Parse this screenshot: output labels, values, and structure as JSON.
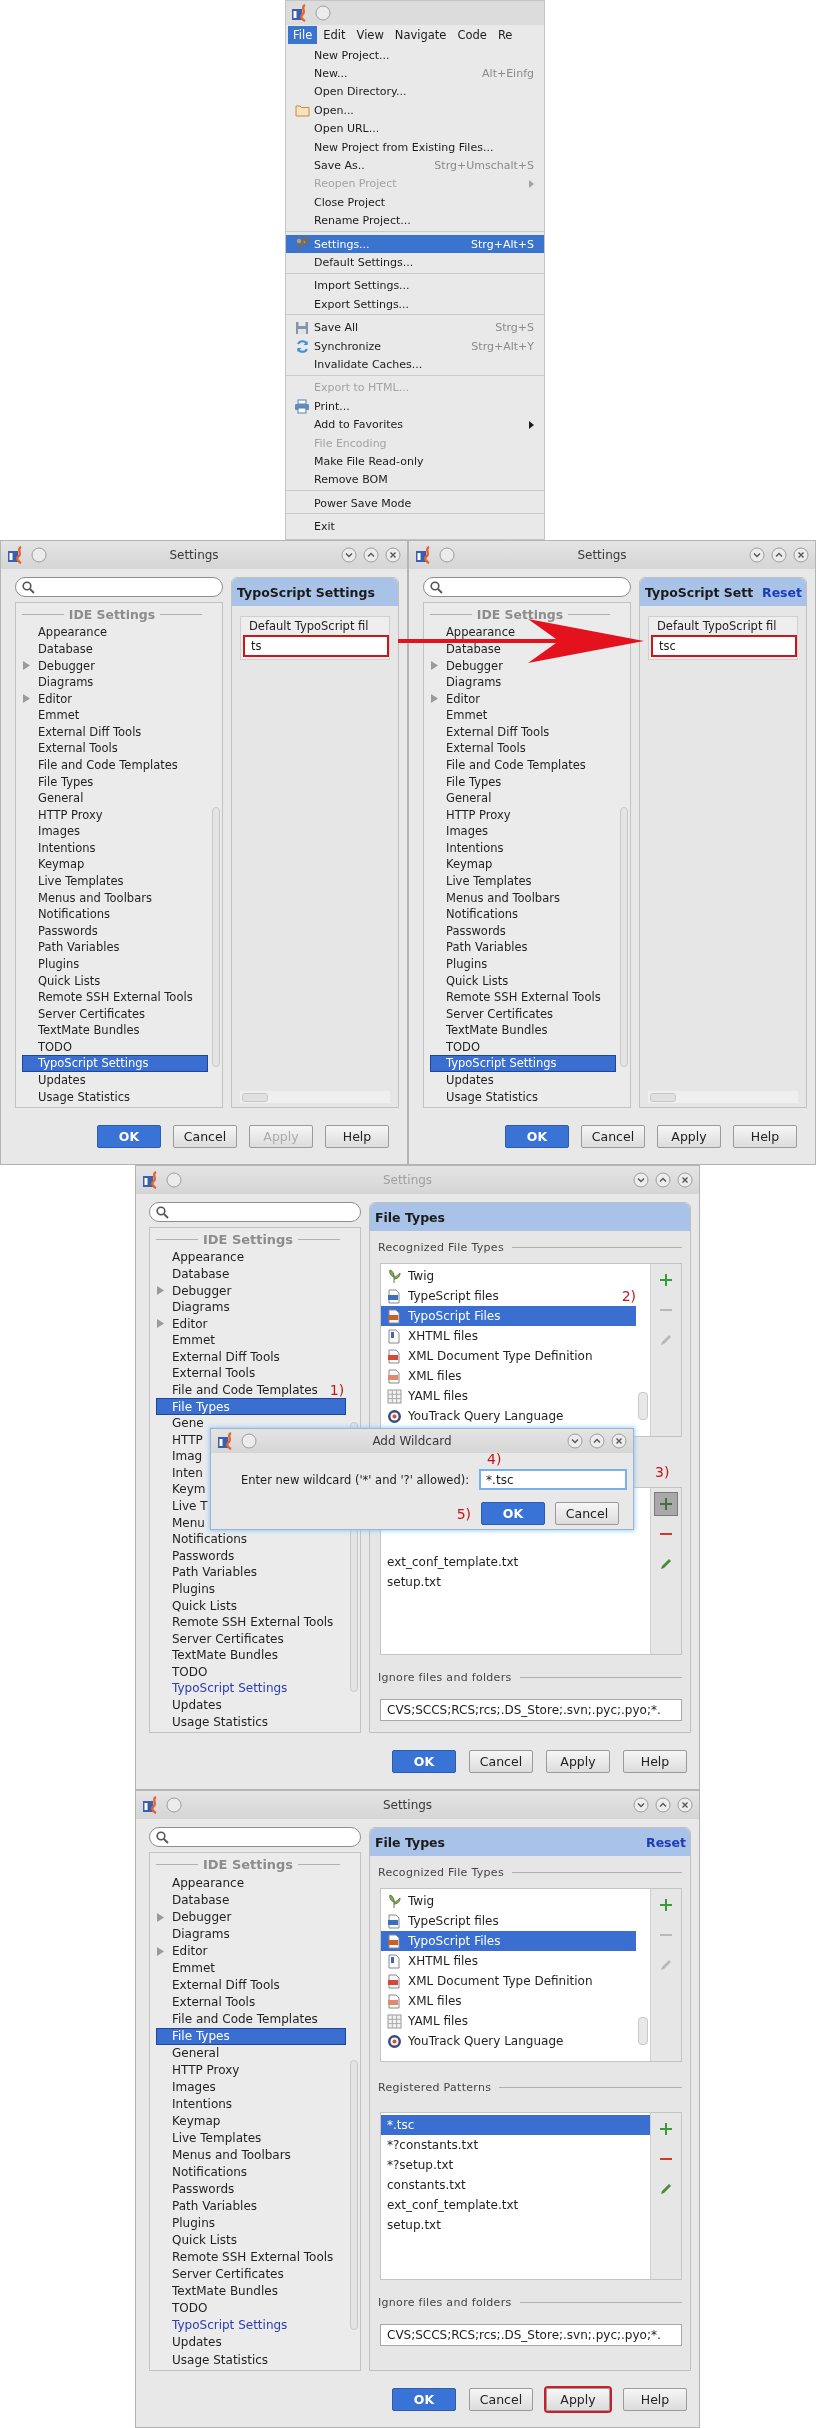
{
  "menu_window": {
    "menubar": [
      {
        "label": "File",
        "selected": true
      },
      {
        "label": "Edit",
        "selected": false
      },
      {
        "label": "View",
        "selected": false
      },
      {
        "label": "Navigate",
        "selected": false
      },
      {
        "label": "Code",
        "selected": false
      },
      {
        "label": "Re",
        "selected": false
      }
    ],
    "menu": [
      {
        "kind": "item",
        "label": "New Project...",
        "selected": false,
        "disabled": false,
        "submenu": false
      },
      {
        "kind": "item",
        "label": "New...",
        "shortcut": "Alt+Einfg",
        "selected": false,
        "disabled": false,
        "submenu": false
      },
      {
        "kind": "item",
        "label": "Open Directory...",
        "selected": false,
        "disabled": false,
        "submenu": false
      },
      {
        "kind": "item",
        "label": "Open...",
        "selected": false,
        "disabled": false,
        "submenu": false
      },
      {
        "kind": "item",
        "label": "Open URL...",
        "selected": false,
        "disabled": false,
        "submenu": false
      },
      {
        "kind": "item",
        "label": "New Project from Existing Files...",
        "selected": false,
        "disabled": false,
        "submenu": false
      },
      {
        "kind": "item",
        "label": "Save As..",
        "shortcut": "Strg+Umschalt+S",
        "selected": false,
        "disabled": false,
        "submenu": false
      },
      {
        "kind": "item",
        "label": "Reopen Project",
        "selected": false,
        "disabled": true,
        "submenu": true
      },
      {
        "kind": "item",
        "label": "Close Project",
        "selected": false,
        "disabled": false,
        "submenu": false
      },
      {
        "kind": "item",
        "label": "Rename Project...",
        "selected": false,
        "disabled": false,
        "submenu": false
      },
      {
        "kind": "separator"
      },
      {
        "kind": "item",
        "label": "Settings...",
        "shortcut": "Strg+Alt+S",
        "selected": true,
        "disabled": false,
        "submenu": false
      },
      {
        "kind": "item",
        "label": "Default Settings...",
        "selected": false,
        "disabled": false,
        "submenu": false
      },
      {
        "kind": "separator"
      },
      {
        "kind": "item",
        "label": "Import Settings...",
        "selected": false,
        "disabled": false,
        "submenu": false
      },
      {
        "kind": "item",
        "label": "Export Settings...",
        "selected": false,
        "disabled": false,
        "submenu": false
      },
      {
        "kind": "separator"
      },
      {
        "kind": "item",
        "label": "Save All",
        "shortcut": "Strg+S",
        "selected": false,
        "disabled": false,
        "submenu": false
      },
      {
        "kind": "item",
        "label": "Synchronize",
        "shortcut": "Strg+Alt+Y",
        "selected": false,
        "disabled": false,
        "submenu": false
      },
      {
        "kind": "item",
        "label": "Invalidate Caches...",
        "selected": false,
        "disabled": false,
        "submenu": false
      },
      {
        "kind": "separator"
      },
      {
        "kind": "item",
        "label": "Export to HTML...",
        "selected": false,
        "disabled": true,
        "submenu": false
      },
      {
        "kind": "item",
        "label": "Print...",
        "selected": false,
        "disabled": false,
        "submenu": false
      },
      {
        "kind": "item",
        "label": "Add to Favorites",
        "selected": false,
        "disabled": false,
        "submenu": true
      },
      {
        "kind": "item",
        "label": "File Encoding",
        "selected": false,
        "disabled": true,
        "submenu": false
      },
      {
        "kind": "item",
        "label": "Make File Read-only",
        "selected": false,
        "disabled": false,
        "submenu": false
      },
      {
        "kind": "item",
        "label": "Remove BOM",
        "selected": false,
        "disabled": false,
        "submenu": false
      },
      {
        "kind": "separator"
      },
      {
        "kind": "item",
        "label": "Power Save Mode",
        "selected": false,
        "disabled": false,
        "submenu": false
      },
      {
        "kind": "separator"
      },
      {
        "kind": "item",
        "label": "Exit",
        "selected": false,
        "disabled": false,
        "submenu": false
      }
    ]
  },
  "dialogs": [
    {
      "title": "Settings",
      "active": true,
      "tree": {
        "heading": "IDE Settings",
        "items": [
          {
            "label": "Appearance",
            "expandable": false,
            "selected": false,
            "modified": false
          },
          {
            "label": "Database",
            "expandable": false,
            "selected": false,
            "modified": false
          },
          {
            "label": "Debugger",
            "expandable": true,
            "selected": false,
            "modified": false
          },
          {
            "label": "Diagrams",
            "expandable": false,
            "selected": false,
            "modified": false
          },
          {
            "label": "Editor",
            "expandable": true,
            "selected": false,
            "modified": false
          },
          {
            "label": "Emmet",
            "expandable": false,
            "selected": false,
            "modified": false
          },
          {
            "label": "External Diff Tools",
            "expandable": false,
            "selected": false,
            "modified": false
          },
          {
            "label": "External Tools",
            "expandable": false,
            "selected": false,
            "modified": false
          },
          {
            "label": "File and Code Templates",
            "expandable": false,
            "selected": false,
            "modified": false
          },
          {
            "label": "File Types",
            "expandable": false,
            "selected": false,
            "modified": false
          },
          {
            "label": "General",
            "expandable": false,
            "selected": false,
            "modified": false
          },
          {
            "label": "HTTP Proxy",
            "expandable": false,
            "selected": false,
            "modified": false
          },
          {
            "label": "Images",
            "expandable": false,
            "selected": false,
            "modified": false
          },
          {
            "label": "Intentions",
            "expandable": false,
            "selected": false,
            "modified": false
          },
          {
            "label": "Keymap",
            "expandable": false,
            "selected": false,
            "modified": false
          },
          {
            "label": "Live Templates",
            "expandable": false,
            "selected": false,
            "modified": false
          },
          {
            "label": "Menus and Toolbars",
            "expandable": false,
            "selected": false,
            "modified": false
          },
          {
            "label": "Notifications",
            "expandable": false,
            "selected": false,
            "modified": false
          },
          {
            "label": "Passwords",
            "expandable": false,
            "selected": false,
            "modified": false
          },
          {
            "label": "Path Variables",
            "expandable": false,
            "selected": false,
            "modified": false
          },
          {
            "label": "Plugins",
            "expandable": false,
            "selected": false,
            "modified": false
          },
          {
            "label": "Quick Lists",
            "expandable": false,
            "selected": false,
            "modified": false
          },
          {
            "label": "Remote SSH External Tools",
            "expandable": false,
            "selected": false,
            "modified": false
          },
          {
            "label": "Server Certificates",
            "expandable": false,
            "selected": false,
            "modified": false
          },
          {
            "label": "TextMate Bundles",
            "expandable": false,
            "selected": false,
            "modified": false
          },
          {
            "label": "TODO",
            "expandable": false,
            "selected": false,
            "modified": false
          },
          {
            "label": "TypoScript Settings",
            "expandable": false,
            "selected": true,
            "modified": false
          },
          {
            "label": "Updates",
            "expandable": false,
            "selected": false,
            "modified": false
          },
          {
            "label": "Usage Statistics",
            "expandable": false,
            "selected": false,
            "modified": false
          }
        ]
      },
      "panel": {
        "kind": "typoscript",
        "title": "TypoScript Settings",
        "field_label": "Default TypoScript fil",
        "field_value": "ts",
        "field_highlighted": true
      },
      "buttons": [
        {
          "label": "OK",
          "kind": "primary",
          "disabled": false,
          "highlighted": false
        },
        {
          "label": "Cancel",
          "kind": "normal",
          "disabled": false,
          "highlighted": false
        },
        {
          "label": "Apply",
          "kind": "normal",
          "disabled": true,
          "highlighted": false
        },
        {
          "label": "Help",
          "kind": "normal",
          "disabled": false,
          "highlighted": false
        }
      ]
    },
    {
      "title": "Settings",
      "active": true,
      "tree": {
        "heading": "IDE Settings",
        "items": [
          {
            "label": "Appearance",
            "expandable": false,
            "selected": false,
            "modified": false
          },
          {
            "label": "Database",
            "expandable": false,
            "selected": false,
            "modified": false
          },
          {
            "label": "Debugger",
            "expandable": true,
            "selected": false,
            "modified": false
          },
          {
            "label": "Diagrams",
            "expandable": false,
            "selected": false,
            "modified": false
          },
          {
            "label": "Editor",
            "expandable": true,
            "selected": false,
            "modified": false
          },
          {
            "label": "Emmet",
            "expandable": false,
            "selected": false,
            "modified": false
          },
          {
            "label": "External Diff Tools",
            "expandable": false,
            "selected": false,
            "modified": false
          },
          {
            "label": "External Tools",
            "expandable": false,
            "selected": false,
            "modified": false
          },
          {
            "label": "File and Code Templates",
            "expandable": false,
            "selected": false,
            "modified": false
          },
          {
            "label": "File Types",
            "expandable": false,
            "selected": false,
            "modified": false
          },
          {
            "label": "General",
            "expandable": false,
            "selected": false,
            "modified": false
          },
          {
            "label": "HTTP Proxy",
            "expandable": false,
            "selected": false,
            "modified": false
          },
          {
            "label": "Images",
            "expandable": false,
            "selected": false,
            "modified": false
          },
          {
            "label": "Intentions",
            "expandable": false,
            "selected": false,
            "modified": false
          },
          {
            "label": "Keymap",
            "expandable": false,
            "selected": false,
            "modified": false
          },
          {
            "label": "Live Templates",
            "expandable": false,
            "selected": false,
            "modified": false
          },
          {
            "label": "Menus and Toolbars",
            "expandable": false,
            "selected": false,
            "modified": false
          },
          {
            "label": "Notifications",
            "expandable": false,
            "selected": false,
            "modified": false
          },
          {
            "label": "Passwords",
            "expandable": false,
            "selected": false,
            "modified": false
          },
          {
            "label": "Path Variables",
            "expandable": false,
            "selected": false,
            "modified": false
          },
          {
            "label": "Plugins",
            "expandable": false,
            "selected": false,
            "modified": false
          },
          {
            "label": "Quick Lists",
            "expandable": false,
            "selected": false,
            "modified": false
          },
          {
            "label": "Remote SSH External Tools",
            "expandable": false,
            "selected": false,
            "modified": false
          },
          {
            "label": "Server Certificates",
            "expandable": false,
            "selected": false,
            "modified": false
          },
          {
            "label": "TextMate Bundles",
            "expandable": false,
            "selected": false,
            "modified": false
          },
          {
            "label": "TODO",
            "expandable": false,
            "selected": false,
            "modified": false
          },
          {
            "label": "TypoScript Settings",
            "expandable": false,
            "selected": true,
            "modified": false
          },
          {
            "label": "Updates",
            "expandable": false,
            "selected": false,
            "modified": false
          },
          {
            "label": "Usage Statistics",
            "expandable": false,
            "selected": false,
            "modified": false
          }
        ]
      },
      "panel": {
        "kind": "typoscript",
        "title": "TypoScript Sett",
        "reset": "Reset",
        "field_label": "Default TypoScript fil",
        "field_value": "tsc",
        "field_highlighted": true
      },
      "buttons": [
        {
          "label": "OK",
          "kind": "primary",
          "disabled": false,
          "highlighted": false
        },
        {
          "label": "Cancel",
          "kind": "normal",
          "disabled": false,
          "highlighted": false
        },
        {
          "label": "Apply",
          "kind": "normal",
          "disabled": false,
          "highlighted": false
        },
        {
          "label": "Help",
          "kind": "normal",
          "disabled": false,
          "highlighted": false
        }
      ]
    },
    {
      "title": "Settings",
      "active": false,
      "tree": {
        "heading": "IDE Settings",
        "items": [
          {
            "label": "Appearance",
            "expandable": false,
            "selected": false,
            "modified": false
          },
          {
            "label": "Database",
            "expandable": false,
            "selected": false,
            "modified": false
          },
          {
            "label": "Debugger",
            "expandable": true,
            "selected": false,
            "modified": false
          },
          {
            "label": "Diagrams",
            "expandable": false,
            "selected": false,
            "modified": false
          },
          {
            "label": "Editor",
            "expandable": true,
            "selected": false,
            "modified": false
          },
          {
            "label": "Emmet",
            "expandable": false,
            "selected": false,
            "modified": false
          },
          {
            "label": "External Diff Tools",
            "expandable": false,
            "selected": false,
            "modified": false
          },
          {
            "label": "External Tools",
            "expandable": false,
            "selected": false,
            "modified": false
          },
          {
            "label": "File and Code Templates",
            "expandable": false,
            "selected": false,
            "modified": false,
            "note": "1)"
          },
          {
            "label": "File Types",
            "expandable": false,
            "selected": true,
            "modified": false
          },
          {
            "label": "Gene",
            "expandable": false,
            "selected": false,
            "modified": false
          },
          {
            "label": "HTTP",
            "expandable": false,
            "selected": false,
            "modified": false
          },
          {
            "label": "Imag",
            "expandable": false,
            "selected": false,
            "modified": false
          },
          {
            "label": "Inten",
            "expandable": false,
            "selected": false,
            "modified": false
          },
          {
            "label": "Keym",
            "expandable": false,
            "selected": false,
            "modified": false
          },
          {
            "label": "Live T",
            "expandable": false,
            "selected": false,
            "modified": false
          },
          {
            "label": "Menu",
            "expandable": false,
            "selected": false,
            "modified": false
          },
          {
            "label": "Notifications",
            "expandable": false,
            "selected": false,
            "modified": false
          },
          {
            "label": "Passwords",
            "expandable": false,
            "selected": false,
            "modified": false
          },
          {
            "label": "Path Variables",
            "expandable": false,
            "selected": false,
            "modified": false
          },
          {
            "label": "Plugins",
            "expandable": false,
            "selected": false,
            "modified": false
          },
          {
            "label": "Quick Lists",
            "expandable": false,
            "selected": false,
            "modified": false
          },
          {
            "label": "Remote SSH External Tools",
            "expandable": false,
            "selected": false,
            "modified": false
          },
          {
            "label": "Server Certificates",
            "expandable": false,
            "selected": false,
            "modified": false
          },
          {
            "label": "TextMate Bundles",
            "expandable": false,
            "selected": false,
            "modified": false
          },
          {
            "label": "TODO",
            "expandable": false,
            "selected": false,
            "modified": false
          },
          {
            "label": "TypoScript Settings",
            "expandable": false,
            "selected": false,
            "modified": true
          },
          {
            "label": "Updates",
            "expandable": false,
            "selected": false,
            "modified": false
          },
          {
            "label": "Usage Statistics",
            "expandable": false,
            "selected": false,
            "modified": false
          }
        ]
      },
      "panel": {
        "kind": "filetypes",
        "title": "File Types",
        "recognized_label": "Recognized File Types",
        "file_types": [
          {
            "label": "Twig",
            "selected": false
          },
          {
            "label": "TypeScript files",
            "selected": false,
            "note": "2)"
          },
          {
            "label": "TypoScript Files",
            "selected": true
          },
          {
            "label": "XHTML files",
            "selected": false
          },
          {
            "label": "XML Document Type Definition",
            "selected": false
          },
          {
            "label": "XML files",
            "selected": false
          },
          {
            "label": "YAML files",
            "selected": false
          },
          {
            "label": "YouTrack Query Language",
            "selected": false
          }
        ],
        "add_pressed": true,
        "add_note": "3)",
        "patterns": [
          {
            "label": "ext_conf_template.txt",
            "selected": false
          },
          {
            "label": "setup.txt",
            "selected": false
          }
        ],
        "ignore_label": "Ignore files and folders",
        "ignore_value": "CVS;SCCS;RCS;rcs;.DS_Store;.svn;.pyc;.pyo;*."
      },
      "popup": {
        "title": "Add Wildcard",
        "prompt": "Enter new wildcard ('*' and '?' allowed):",
        "value": "*.tsc",
        "value_note": "4)",
        "buttons": [
          {
            "label": "OK",
            "kind": "primary",
            "disabled": false,
            "highlighted": false,
            "note": "5)"
          },
          {
            "label": "Cancel",
            "kind": "normal",
            "disabled": false,
            "highlighted": false
          }
        ]
      },
      "buttons": [
        {
          "label": "OK",
          "kind": "primary",
          "disabled": false,
          "highlighted": false
        },
        {
          "label": "Cancel",
          "kind": "normal",
          "disabled": false,
          "highlighted": false
        },
        {
          "label": "Apply",
          "kind": "normal",
          "disabled": false,
          "highlighted": false
        },
        {
          "label": "Help",
          "kind": "normal",
          "disabled": false,
          "highlighted": false
        }
      ]
    },
    {
      "title": "Settings",
      "active": true,
      "tree": {
        "heading": "IDE Settings",
        "items": [
          {
            "label": "Appearance",
            "expandable": false,
            "selected": false,
            "modified": false
          },
          {
            "label": "Database",
            "expandable": false,
            "selected": false,
            "modified": false
          },
          {
            "label": "Debugger",
            "expandable": true,
            "selected": false,
            "modified": false
          },
          {
            "label": "Diagrams",
            "expandable": false,
            "selected": false,
            "modified": false
          },
          {
            "label": "Editor",
            "expandable": true,
            "selected": false,
            "modified": false
          },
          {
            "label": "Emmet",
            "expandable": false,
            "selected": false,
            "modified": false
          },
          {
            "label": "External Diff Tools",
            "expandable": false,
            "selected": false,
            "modified": false
          },
          {
            "label": "External Tools",
            "expandable": false,
            "selected": false,
            "modified": false
          },
          {
            "label": "File and Code Templates",
            "expandable": false,
            "selected": false,
            "modified": false
          },
          {
            "label": "File Types",
            "expandable": false,
            "selected": true,
            "modified": false
          },
          {
            "label": "General",
            "expandable": false,
            "selected": false,
            "modified": false
          },
          {
            "label": "HTTP Proxy",
            "expandable": false,
            "selected": false,
            "modified": false
          },
          {
            "label": "Images",
            "expandable": false,
            "selected": false,
            "modified": false
          },
          {
            "label": "Intentions",
            "expandable": false,
            "selected": false,
            "modified": false
          },
          {
            "label": "Keymap",
            "expandable": false,
            "selected": false,
            "modified": false
          },
          {
            "label": "Live Templates",
            "expandable": false,
            "selected": false,
            "modified": false
          },
          {
            "label": "Menus and Toolbars",
            "expandable": false,
            "selected": false,
            "modified": false
          },
          {
            "label": "Notifications",
            "expandable": false,
            "selected": false,
            "modified": false
          },
          {
            "label": "Passwords",
            "expandable": false,
            "selected": false,
            "modified": false
          },
          {
            "label": "Path Variables",
            "expandable": false,
            "selected": false,
            "modified": false
          },
          {
            "label": "Plugins",
            "expandable": false,
            "selected": false,
            "modified": false
          },
          {
            "label": "Quick Lists",
            "expandable": false,
            "selected": false,
            "modified": false
          },
          {
            "label": "Remote SSH External Tools",
            "expandable": false,
            "selected": false,
            "modified": false
          },
          {
            "label": "Server Certificates",
            "expandable": false,
            "selected": false,
            "modified": false
          },
          {
            "label": "TextMate Bundles",
            "expandable": false,
            "selected": false,
            "modified": false
          },
          {
            "label": "TODO",
            "expandable": false,
            "selected": false,
            "modified": false
          },
          {
            "label": "TypoScript Settings",
            "expandable": false,
            "selected": false,
            "modified": true
          },
          {
            "label": "Updates",
            "expandable": false,
            "selected": false,
            "modified": false
          },
          {
            "label": "Usage Statistics",
            "expandable": false,
            "selected": false,
            "modified": false
          }
        ]
      },
      "panel": {
        "kind": "filetypes",
        "title": "File Types",
        "reset": "Reset",
        "recognized_label": "Recognized File Types",
        "file_types": [
          {
            "label": "Twig",
            "selected": false
          },
          {
            "label": "TypeScript files",
            "selected": false
          },
          {
            "label": "TypoScript Files",
            "selected": true
          },
          {
            "label": "XHTML files",
            "selected": false
          },
          {
            "label": "XML Document Type Definition",
            "selected": false
          },
          {
            "label": "XML files",
            "selected": false
          },
          {
            "label": "YAML files",
            "selected": false
          },
          {
            "label": "YouTrack Query Language",
            "selected": false
          }
        ],
        "patterns_label": "Registered Patterns",
        "add_pressed": false,
        "patterns": [
          {
            "label": "*.tsc",
            "selected": true
          },
          {
            "label": "*?constants.txt",
            "selected": false
          },
          {
            "label": "*?setup.txt",
            "selected": false
          },
          {
            "label": "constants.txt",
            "selected": false
          },
          {
            "label": "ext_conf_template.txt",
            "selected": false
          },
          {
            "label": "setup.txt",
            "selected": false
          }
        ],
        "ignore_label": "Ignore files and folders",
        "ignore_value": "CVS;SCCS;RCS;rcs;.DS_Store;.svn;.pyc;.pyo;*."
      },
      "buttons": [
        {
          "label": "OK",
          "kind": "primary",
          "disabled": false,
          "highlighted": false
        },
        {
          "label": "Cancel",
          "kind": "normal",
          "disabled": false,
          "highlighted": false
        },
        {
          "label": "Apply",
          "kind": "normal",
          "disabled": false,
          "highlighted": true
        },
        {
          "label": "Help",
          "kind": "normal",
          "disabled": false,
          "highlighted": false
        }
      ]
    }
  ]
}
